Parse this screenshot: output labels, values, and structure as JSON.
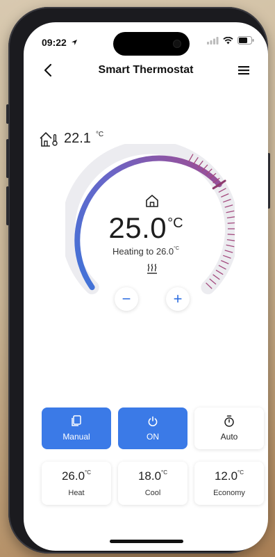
{
  "status": {
    "time": "09:22"
  },
  "header": {
    "title": "Smart Thermostat"
  },
  "indoor": {
    "value": "22.1",
    "unit": "°C"
  },
  "dial": {
    "target_value": "25.0",
    "target_unit": "°C",
    "heating_prefix": "Heating to ",
    "heating_value": "26.0",
    "heating_unit": "°C",
    "arc_color_start": "#3f73d8",
    "arc_color_end": "#b04a86",
    "minus_label": "−",
    "plus_label": "+"
  },
  "modes": [
    {
      "label": "Manual",
      "active": true
    },
    {
      "label": "ON",
      "active": true
    },
    {
      "label": "Auto",
      "active": false
    }
  ],
  "presets": [
    {
      "value": "26.0",
      "unit": "°C",
      "label": "Heat"
    },
    {
      "value": "18.0",
      "unit": "°C",
      "label": "Cool"
    },
    {
      "value": "12.0",
      "unit": "°C",
      "label": "Economy"
    }
  ],
  "colors": {
    "accent": "#3b7ae7"
  }
}
